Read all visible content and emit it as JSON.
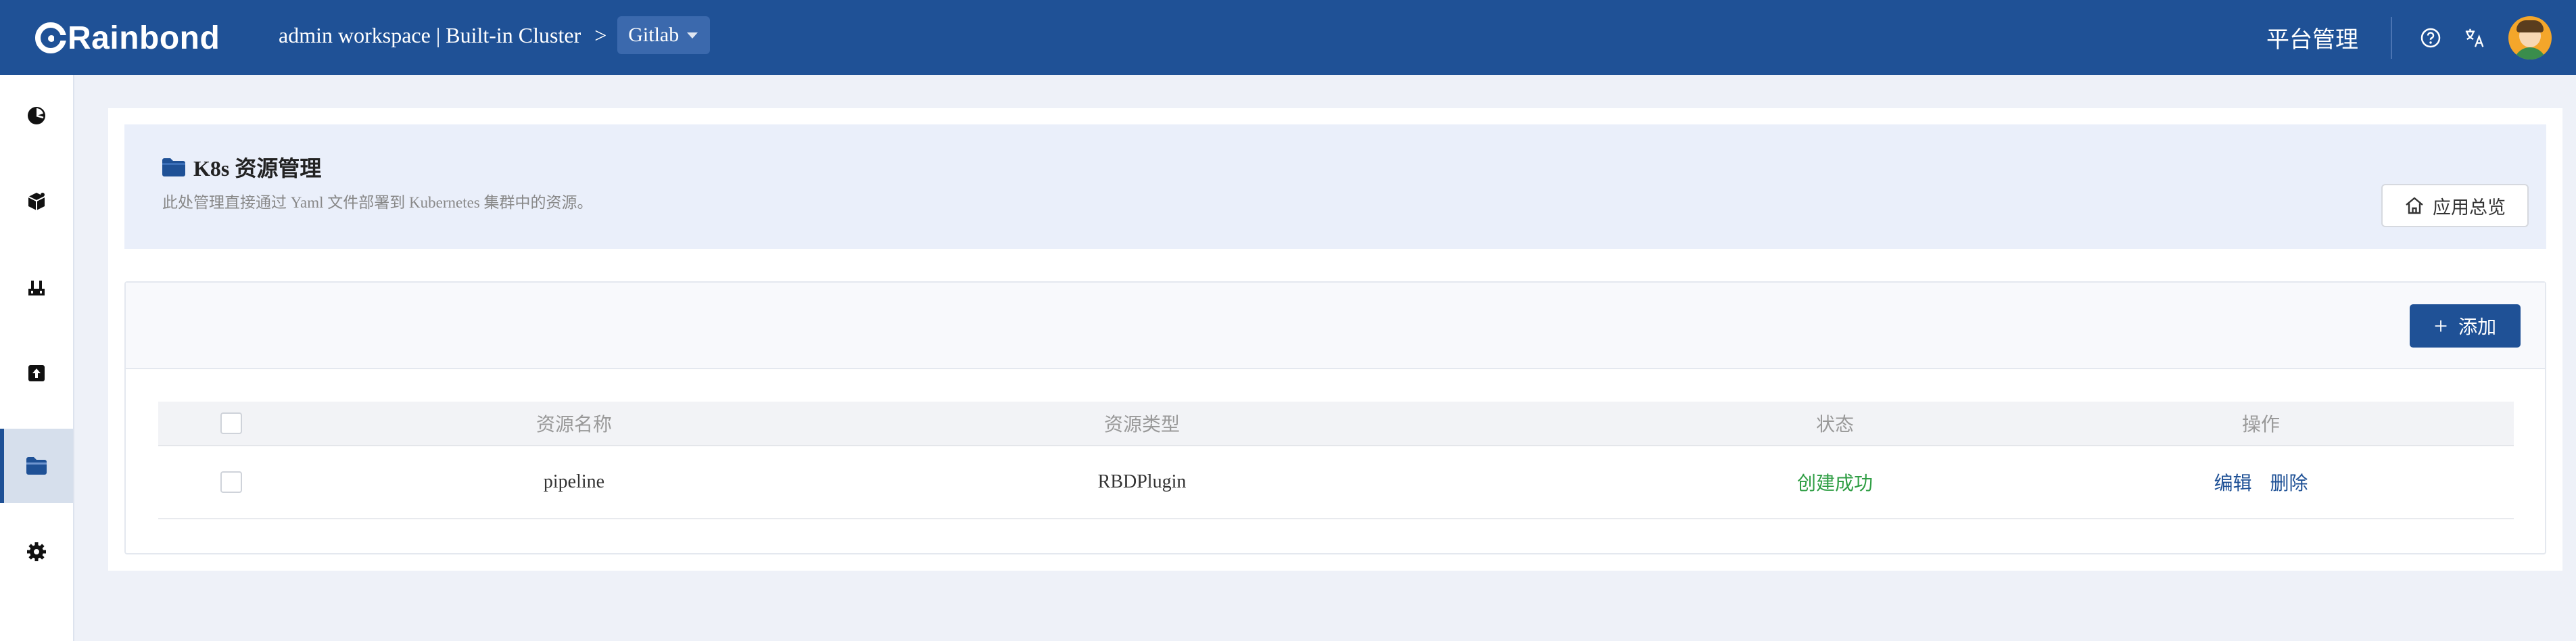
{
  "header": {
    "logo_text": "Rainbond",
    "workspace": "admin workspace | Built-in Cluster",
    "separator": ">",
    "app_name": "Gitlab",
    "platform_label": "平台管理",
    "icons": [
      "help-icon",
      "language-icon",
      "user-avatar"
    ]
  },
  "sidebar": {
    "items": [
      {
        "name": "overview",
        "icon": "dashboard-icon"
      },
      {
        "name": "components",
        "icon": "cube-icon"
      },
      {
        "name": "gateway",
        "icon": "gateway-icon"
      },
      {
        "name": "publish",
        "icon": "upload-icon"
      },
      {
        "name": "k8s-resources",
        "icon": "folder-icon",
        "active": true
      },
      {
        "name": "settings",
        "icon": "gear-icon"
      }
    ]
  },
  "intro": {
    "title": "K8s 资源管理",
    "description": "此处管理直接通过 Yaml 文件部署到 Kubernetes 集群中的资源。",
    "overview_button": "应用总览"
  },
  "toolbar": {
    "add_label": "添加",
    "add_symbol": "+"
  },
  "table": {
    "columns": [
      "资源名称",
      "资源类型",
      "状态",
      "操作"
    ],
    "rows": [
      {
        "name": "pipeline",
        "type": "RBDPlugin",
        "status": "创建成功",
        "actions": [
          "编辑",
          "删除"
        ]
      }
    ]
  },
  "colors": {
    "header_bg": "#1f5196",
    "primary": "#1f5196",
    "success": "#2f9e44",
    "intro_bg": "#eaeffa"
  }
}
